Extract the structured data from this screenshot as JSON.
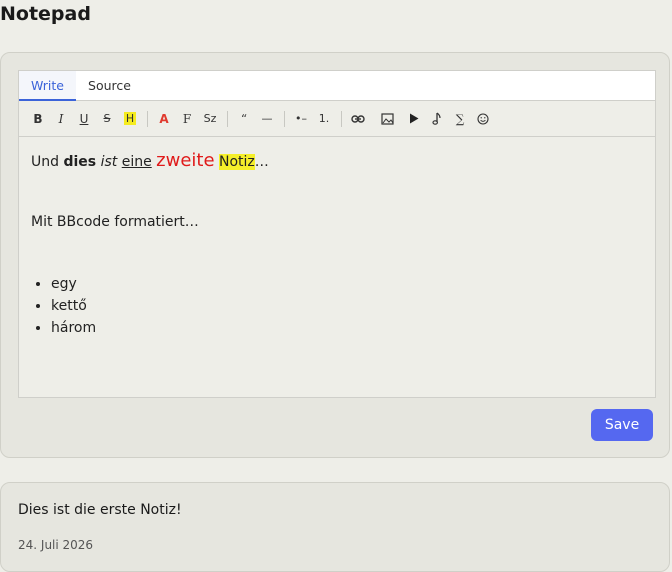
{
  "app": {
    "title": "Notepad"
  },
  "editor": {
    "tabs": [
      {
        "label": "Write",
        "active": true
      },
      {
        "label": "Source",
        "active": false
      }
    ],
    "toolbar": {
      "bold": "B",
      "italic": "I",
      "underline": "U",
      "strike": "S",
      "highlight": "H",
      "color": "A",
      "font": "F",
      "size": "Sz",
      "quote": "“",
      "hr": "—",
      "bullet_list": "•–",
      "ordered_list": "1.",
      "sigma": "∑"
    },
    "content": {
      "line1": [
        "Und",
        "dies",
        "ist",
        "eine",
        "zweite",
        "Notiz",
        "…"
      ],
      "line2": "Mit BBcode formatiert…",
      "list": [
        "egy",
        "kettő",
        "három"
      ]
    },
    "save_label": "Save"
  },
  "notes": [
    {
      "text": "Dies ist die erste Notiz!",
      "date": "24. Juli 2026"
    }
  ],
  "colors": {
    "accent": "#5568f0",
    "highlight": "#f5ef2a",
    "red": "#e01a1a"
  }
}
